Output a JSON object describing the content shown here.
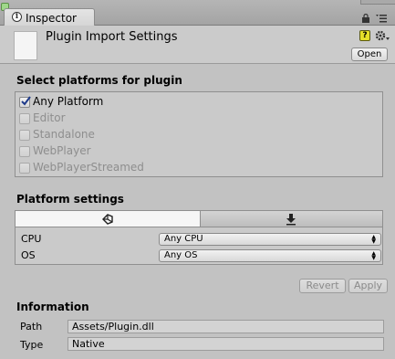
{
  "tab": {
    "label": "Inspector",
    "icon": "info-icon"
  },
  "header": {
    "title": "Plugin Import Settings",
    "open_button": "Open",
    "icons": [
      "file-icon",
      "help-icon",
      "gear-icon",
      "lock-icon",
      "menu-icon"
    ]
  },
  "platforms": {
    "title": "Select platforms for plugin",
    "items": [
      {
        "label": "Any Platform",
        "checked": true,
        "enabled": true
      },
      {
        "label": "Editor",
        "checked": false,
        "enabled": false
      },
      {
        "label": "Standalone",
        "checked": false,
        "enabled": false
      },
      {
        "label": "WebPlayer",
        "checked": false,
        "enabled": false
      },
      {
        "label": "WebPlayerStreamed",
        "checked": false,
        "enabled": false
      }
    ]
  },
  "platform_settings": {
    "title": "Platform settings",
    "tabs": [
      "unity-icon",
      "download-icon"
    ],
    "rows": [
      {
        "label": "CPU",
        "value": "Any CPU"
      },
      {
        "label": "OS",
        "value": "Any OS"
      }
    ]
  },
  "buttons": {
    "revert": "Revert",
    "apply": "Apply"
  },
  "information": {
    "title": "Information",
    "path_label": "Path",
    "path_value": "Assets/Plugin.dll",
    "type_label": "Type",
    "type_value": "Native"
  }
}
